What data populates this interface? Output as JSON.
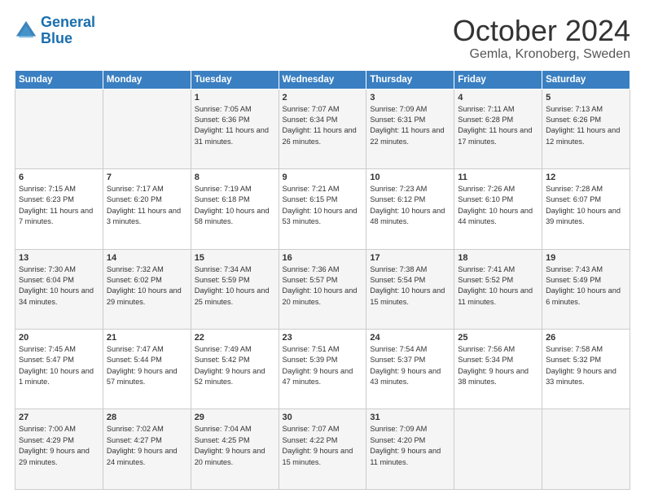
{
  "logo": {
    "line1": "General",
    "line2": "Blue"
  },
  "title": "October 2024",
  "subtitle": "Gemla, Kronoberg, Sweden",
  "weekdays": [
    "Sunday",
    "Monday",
    "Tuesday",
    "Wednesday",
    "Thursday",
    "Friday",
    "Saturday"
  ],
  "weeks": [
    [
      {
        "day": "",
        "info": ""
      },
      {
        "day": "",
        "info": ""
      },
      {
        "day": "1",
        "info": "Sunrise: 7:05 AM\nSunset: 6:36 PM\nDaylight: 11 hours and 31 minutes."
      },
      {
        "day": "2",
        "info": "Sunrise: 7:07 AM\nSunset: 6:34 PM\nDaylight: 11 hours and 26 minutes."
      },
      {
        "day": "3",
        "info": "Sunrise: 7:09 AM\nSunset: 6:31 PM\nDaylight: 11 hours and 22 minutes."
      },
      {
        "day": "4",
        "info": "Sunrise: 7:11 AM\nSunset: 6:28 PM\nDaylight: 11 hours and 17 minutes."
      },
      {
        "day": "5",
        "info": "Sunrise: 7:13 AM\nSunset: 6:26 PM\nDaylight: 11 hours and 12 minutes."
      }
    ],
    [
      {
        "day": "6",
        "info": "Sunrise: 7:15 AM\nSunset: 6:23 PM\nDaylight: 11 hours and 7 minutes."
      },
      {
        "day": "7",
        "info": "Sunrise: 7:17 AM\nSunset: 6:20 PM\nDaylight: 11 hours and 3 minutes."
      },
      {
        "day": "8",
        "info": "Sunrise: 7:19 AM\nSunset: 6:18 PM\nDaylight: 10 hours and 58 minutes."
      },
      {
        "day": "9",
        "info": "Sunrise: 7:21 AM\nSunset: 6:15 PM\nDaylight: 10 hours and 53 minutes."
      },
      {
        "day": "10",
        "info": "Sunrise: 7:23 AM\nSunset: 6:12 PM\nDaylight: 10 hours and 48 minutes."
      },
      {
        "day": "11",
        "info": "Sunrise: 7:26 AM\nSunset: 6:10 PM\nDaylight: 10 hours and 44 minutes."
      },
      {
        "day": "12",
        "info": "Sunrise: 7:28 AM\nSunset: 6:07 PM\nDaylight: 10 hours and 39 minutes."
      }
    ],
    [
      {
        "day": "13",
        "info": "Sunrise: 7:30 AM\nSunset: 6:04 PM\nDaylight: 10 hours and 34 minutes."
      },
      {
        "day": "14",
        "info": "Sunrise: 7:32 AM\nSunset: 6:02 PM\nDaylight: 10 hours and 29 minutes."
      },
      {
        "day": "15",
        "info": "Sunrise: 7:34 AM\nSunset: 5:59 PM\nDaylight: 10 hours and 25 minutes."
      },
      {
        "day": "16",
        "info": "Sunrise: 7:36 AM\nSunset: 5:57 PM\nDaylight: 10 hours and 20 minutes."
      },
      {
        "day": "17",
        "info": "Sunrise: 7:38 AM\nSunset: 5:54 PM\nDaylight: 10 hours and 15 minutes."
      },
      {
        "day": "18",
        "info": "Sunrise: 7:41 AM\nSunset: 5:52 PM\nDaylight: 10 hours and 11 minutes."
      },
      {
        "day": "19",
        "info": "Sunrise: 7:43 AM\nSunset: 5:49 PM\nDaylight: 10 hours and 6 minutes."
      }
    ],
    [
      {
        "day": "20",
        "info": "Sunrise: 7:45 AM\nSunset: 5:47 PM\nDaylight: 10 hours and 1 minute."
      },
      {
        "day": "21",
        "info": "Sunrise: 7:47 AM\nSunset: 5:44 PM\nDaylight: 9 hours and 57 minutes."
      },
      {
        "day": "22",
        "info": "Sunrise: 7:49 AM\nSunset: 5:42 PM\nDaylight: 9 hours and 52 minutes."
      },
      {
        "day": "23",
        "info": "Sunrise: 7:51 AM\nSunset: 5:39 PM\nDaylight: 9 hours and 47 minutes."
      },
      {
        "day": "24",
        "info": "Sunrise: 7:54 AM\nSunset: 5:37 PM\nDaylight: 9 hours and 43 minutes."
      },
      {
        "day": "25",
        "info": "Sunrise: 7:56 AM\nSunset: 5:34 PM\nDaylight: 9 hours and 38 minutes."
      },
      {
        "day": "26",
        "info": "Sunrise: 7:58 AM\nSunset: 5:32 PM\nDaylight: 9 hours and 33 minutes."
      }
    ],
    [
      {
        "day": "27",
        "info": "Sunrise: 7:00 AM\nSunset: 4:29 PM\nDaylight: 9 hours and 29 minutes."
      },
      {
        "day": "28",
        "info": "Sunrise: 7:02 AM\nSunset: 4:27 PM\nDaylight: 9 hours and 24 minutes."
      },
      {
        "day": "29",
        "info": "Sunrise: 7:04 AM\nSunset: 4:25 PM\nDaylight: 9 hours and 20 minutes."
      },
      {
        "day": "30",
        "info": "Sunrise: 7:07 AM\nSunset: 4:22 PM\nDaylight: 9 hours and 15 minutes."
      },
      {
        "day": "31",
        "info": "Sunrise: 7:09 AM\nSunset: 4:20 PM\nDaylight: 9 hours and 11 minutes."
      },
      {
        "day": "",
        "info": ""
      },
      {
        "day": "",
        "info": ""
      }
    ]
  ]
}
